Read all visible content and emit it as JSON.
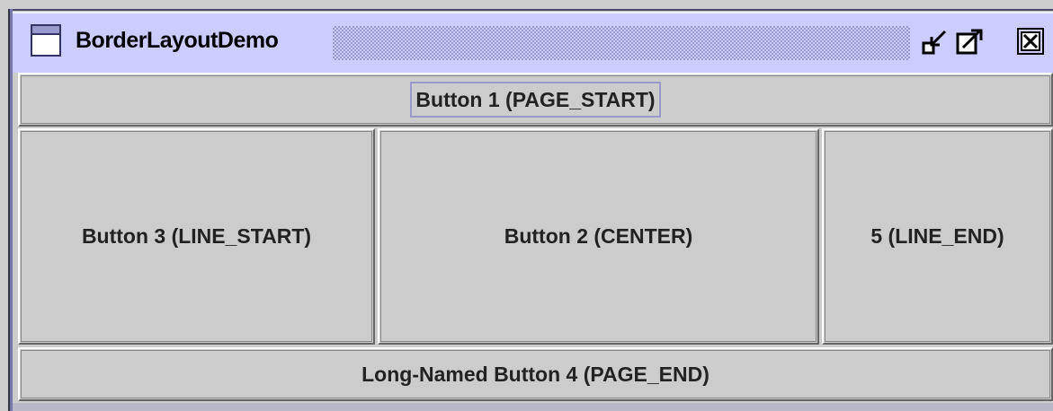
{
  "window": {
    "title": "BorderLayoutDemo",
    "controls": {
      "iconify_icon": "iconify-icon",
      "maximize_icon": "maximize-icon",
      "close_icon": "close-icon"
    }
  },
  "buttons": {
    "page_start": "Button 1 (PAGE_START)",
    "line_start": "Button 3 (LINE_START)",
    "center": "Button 2 (CENTER)",
    "line_end": "5 (LINE_END)",
    "page_end": "Long-Named Button 4 (PAGE_END)"
  },
  "colors": {
    "titlebar": "#ccccff",
    "background": "#cccccc",
    "focus_border": "#9999cc"
  }
}
